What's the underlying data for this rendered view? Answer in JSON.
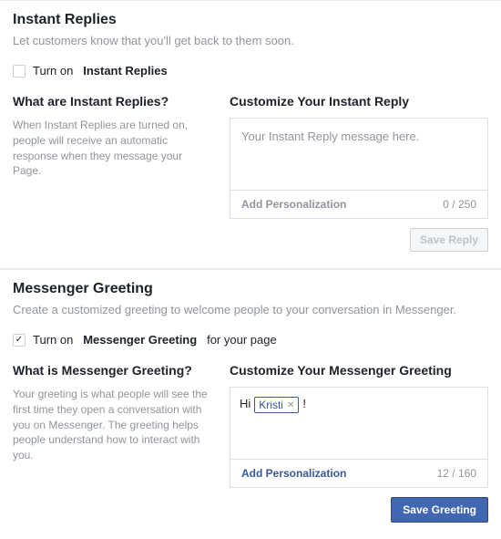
{
  "instantReplies": {
    "title": "Instant Replies",
    "description": "Let customers know that you'll get back to them soon.",
    "checkbox": {
      "prefix": "Turn on",
      "bold": "Instant Replies",
      "checked": false
    },
    "left": {
      "title": "What are Instant Replies?",
      "desc": "When Instant Replies are turned on, people will receive an automatic response when they message your Page."
    },
    "right": {
      "title": "Customize Your Instant Reply",
      "placeholder": "Your Instant Reply message here.",
      "personalization": "Add Personalization",
      "counter": "0 / 250",
      "saveLabel": "Save Reply"
    }
  },
  "messengerGreeting": {
    "title": "Messenger Greeting",
    "description": "Create a customized greeting to welcome people to your conversation in Messenger.",
    "checkbox": {
      "prefix": "Turn on",
      "bold": "Messenger Greeting",
      "suffix": "for your page",
      "checked": true
    },
    "left": {
      "title": "What is Messenger Greeting?",
      "desc": "Your greeting is what people will see the first time they open a conversation with you on Messenger. The greeting helps people understand how to interact with you."
    },
    "right": {
      "title": "Customize Your Messenger Greeting",
      "prefix": "Hi",
      "tokenName": "Kristi",
      "suffix": "!",
      "personalization": "Add Personalization",
      "counter": "12 / 160",
      "saveLabel": "Save Greeting"
    }
  }
}
